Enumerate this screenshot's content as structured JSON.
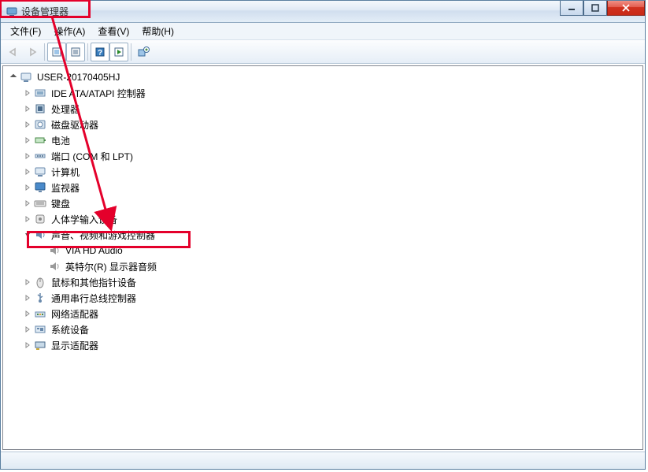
{
  "window": {
    "title": "设备管理器"
  },
  "menus": {
    "file": "文件(F)",
    "action": "操作(A)",
    "view": "查看(V)",
    "help": "帮助(H)"
  },
  "tree": {
    "root": "USER-20170405HJ",
    "items": [
      {
        "label": "IDE ATA/ATAPI 控制器"
      },
      {
        "label": "处理器"
      },
      {
        "label": "磁盘驱动器"
      },
      {
        "label": "电池"
      },
      {
        "label": "端口 (COM 和 LPT)"
      },
      {
        "label": "计算机"
      },
      {
        "label": "监视器"
      },
      {
        "label": "键盘"
      },
      {
        "label": "人体学输入设备"
      },
      {
        "label": "声音、视频和游戏控制器",
        "children": [
          {
            "label": "VIA HD Audio"
          },
          {
            "label": "英特尔(R) 显示器音频"
          }
        ]
      },
      {
        "label": "鼠标和其他指针设备"
      },
      {
        "label": "通用串行总线控制器"
      },
      {
        "label": "网络适配器"
      },
      {
        "label": "系统设备"
      },
      {
        "label": "显示适配器"
      }
    ]
  }
}
